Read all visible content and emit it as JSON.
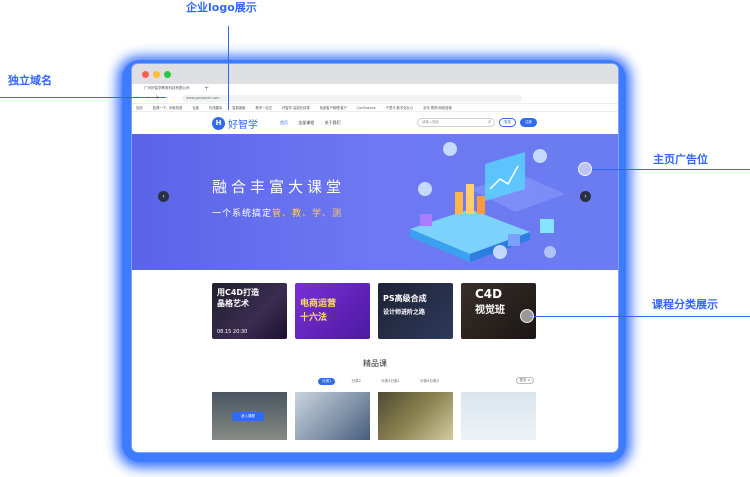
{
  "browser": {
    "tab_title": "广州好智学教育科技有限公司",
    "tab_plus": "+",
    "url": "www.gzhaozhi.com",
    "nav_icons": "← → ↻",
    "bookmarks": [
      "应用",
      "蓝课一下，你就知道",
      "百度",
      "在线翻译",
      "智能客服",
      "教学一站式",
      "好智学·高能在线课",
      "免费客户管理·客户",
      "Confluence",
      "千里马·数字化办公",
      "京东·购物·网络营销"
    ]
  },
  "site": {
    "logo_letter": "H",
    "logo_text": "好智学",
    "nav": [
      "首页",
      "全部课程",
      "关于我们"
    ],
    "search_placeholder": "请输入搜索",
    "search_icon": "search-icon",
    "login": "登录",
    "register": "注册"
  },
  "banner": {
    "title": "融合丰富大课堂",
    "subtitle_pre": "一个系统搞定",
    "subtitle_hl": "管、教、学、测",
    "prev": "‹",
    "next": "›"
  },
  "categories": [
    {
      "l1": "用C4D打造",
      "l2": "晶格艺术",
      "l3": "08.15 20:30"
    },
    {
      "l1": "电商运营",
      "l2": "十六法",
      "l3": ""
    },
    {
      "l1": "PS高级合成",
      "l2": "设计师进阶之路",
      "l3": ""
    },
    {
      "l1": "C4D",
      "l2": "视觉班",
      "l3": ""
    }
  ],
  "section": {
    "title": "精品课",
    "filters": [
      "分类1",
      "分类2",
      "分类3分类1",
      "分类4分类5"
    ],
    "more": "更多 >"
  },
  "cards": {
    "enter_label": "进入课程"
  },
  "annotations": {
    "logo_display": "企业logo展示",
    "domain": "独立域名",
    "home_ad": "主页广告位",
    "course_category": "课程分类展示"
  },
  "colors": {
    "accent": "#2f6cf2",
    "annotation": "#3366ff",
    "banner_start": "#5b63e8",
    "banner_end": "#6a7cf0",
    "highlight": "#ffc86a"
  }
}
